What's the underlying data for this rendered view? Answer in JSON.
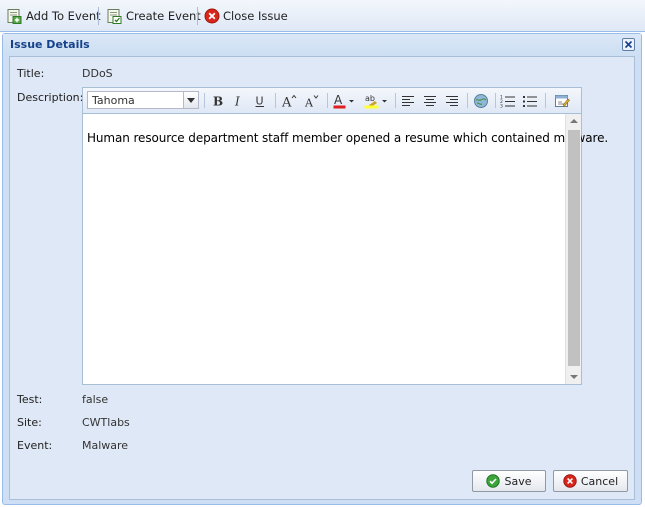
{
  "toolbar": {
    "add_to_event": "Add To Event",
    "create_event": "Create Event",
    "close_issue": "Close Issue"
  },
  "window": {
    "title": "Issue Details"
  },
  "fields": {
    "title_label": "Title:",
    "title_value": "DDoS",
    "description_label": "Description:",
    "test_label": "Test:",
    "test_value": "false",
    "site_label": "Site:",
    "site_value": "CWTlabs",
    "event_label": "Event:",
    "event_value": "Malware"
  },
  "editor": {
    "font_family": "Tahoma",
    "content": "Human resource department staff member opened a resume which contained malware."
  },
  "buttons": {
    "save": "Save",
    "cancel": "Cancel"
  },
  "colors": {
    "title_text": "#15428b",
    "panel_bg": "#dfe8f6",
    "border": "#99bbe8",
    "close_red": "#d9261c",
    "save_green": "#3aa63a"
  },
  "icons": {
    "add_to_event": "add-to-event-icon",
    "create_event": "create-event-icon",
    "close_issue": "close-issue-icon",
    "window_close": "close-icon",
    "save": "check-icon",
    "cancel": "cancel-icon"
  }
}
